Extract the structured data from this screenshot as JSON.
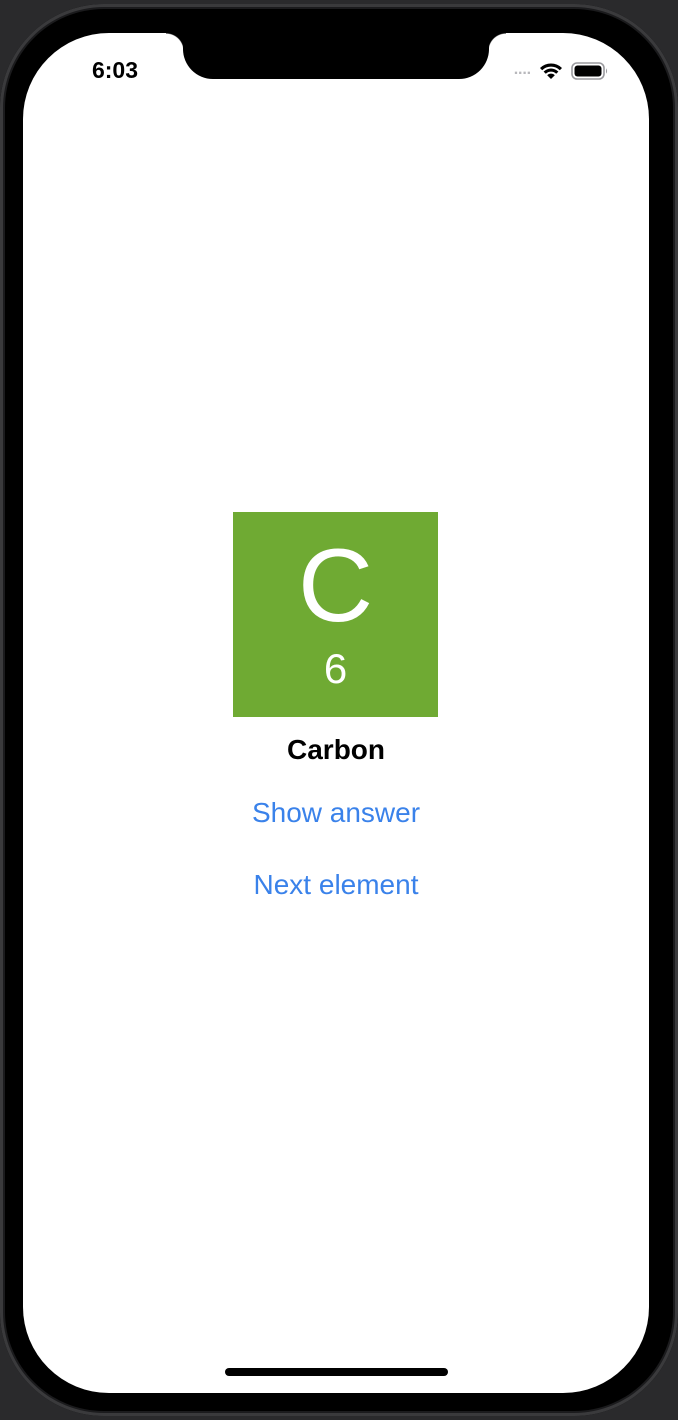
{
  "status_bar": {
    "time": "6:03",
    "signal_icon": "cellular-signal-icon",
    "wifi_icon": "wifi-icon",
    "battery_icon": "battery-icon"
  },
  "element_card": {
    "symbol": "C",
    "atomic_number": "6",
    "name": "Carbon",
    "tile_color": "#6faa33"
  },
  "actions": {
    "show_answer_label": "Show answer",
    "next_element_label": "Next element",
    "link_color": "#3a82ea"
  }
}
